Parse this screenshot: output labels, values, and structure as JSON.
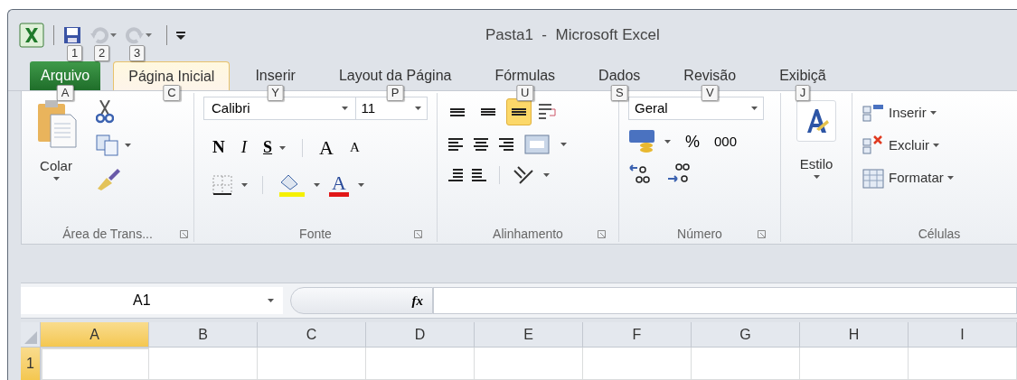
{
  "window": {
    "title": "Pasta1  -  Microsoft Excel"
  },
  "quick_access": [
    {
      "kind": "save",
      "keytip": "1",
      "disabled": false
    },
    {
      "kind": "undo",
      "keytip": "2",
      "disabled": true
    },
    {
      "kind": "redo",
      "keytip": "3",
      "disabled": true
    }
  ],
  "tabs": [
    {
      "label": "Arquivo",
      "kind": "file",
      "selected": false,
      "keytip": "A"
    },
    {
      "label": "Página Inicial",
      "kind": "tab",
      "selected": true,
      "keytip": "C"
    },
    {
      "label": "Inserir",
      "kind": "tab",
      "selected": false,
      "keytip": "Y"
    },
    {
      "label": "Layout da Página",
      "kind": "tab",
      "selected": false,
      "keytip": "P"
    },
    {
      "label": "Fórmulas",
      "kind": "tab",
      "selected": false,
      "keytip": "U"
    },
    {
      "label": "Dados",
      "kind": "tab",
      "selected": false,
      "keytip": "S"
    },
    {
      "label": "Revisão",
      "kind": "tab",
      "selected": false,
      "keytip": "V"
    },
    {
      "label": "Exibiçã",
      "kind": "tab",
      "selected": false,
      "keytip": "J"
    }
  ],
  "ribbon": {
    "clipboard": {
      "paste_label": "Colar",
      "group_label": "Área de Trans..."
    },
    "font": {
      "name": "Calibri",
      "size": "11",
      "bold": "N",
      "italic": "I",
      "underline": "S",
      "grow": "A",
      "shrink": "A",
      "font_color": "A",
      "group_label": "Fonte"
    },
    "alignment": {
      "vertical": [
        {
          "kind": "top",
          "selected": false
        },
        {
          "kind": "middle",
          "selected": false
        },
        {
          "kind": "bottom",
          "selected": true
        }
      ],
      "group_label": "Alinhamento"
    },
    "number": {
      "format": "Geral",
      "percent": "%",
      "thousands": "000",
      "group_label": "Número"
    },
    "styles": {
      "label": "Estilo"
    },
    "cells": {
      "items": [
        {
          "kind": "insert",
          "label": "Inserir"
        },
        {
          "kind": "delete",
          "label": "Excluir"
        },
        {
          "kind": "format",
          "label": "Formatar"
        }
      ],
      "group_label": "Células"
    }
  },
  "formula_bar": {
    "name_box": "A1",
    "function_label": "fx"
  },
  "grid": {
    "columns": [
      {
        "label": "A",
        "selected": true
      },
      {
        "label": "B",
        "selected": false
      },
      {
        "label": "C",
        "selected": false
      },
      {
        "label": "D",
        "selected": false
      },
      {
        "label": "E",
        "selected": false
      },
      {
        "label": "F",
        "selected": false
      },
      {
        "label": "G",
        "selected": false
      },
      {
        "label": "H",
        "selected": false
      },
      {
        "label": "I",
        "selected": false
      }
    ],
    "rows": [
      {
        "label": "1",
        "selected": true
      }
    ]
  }
}
